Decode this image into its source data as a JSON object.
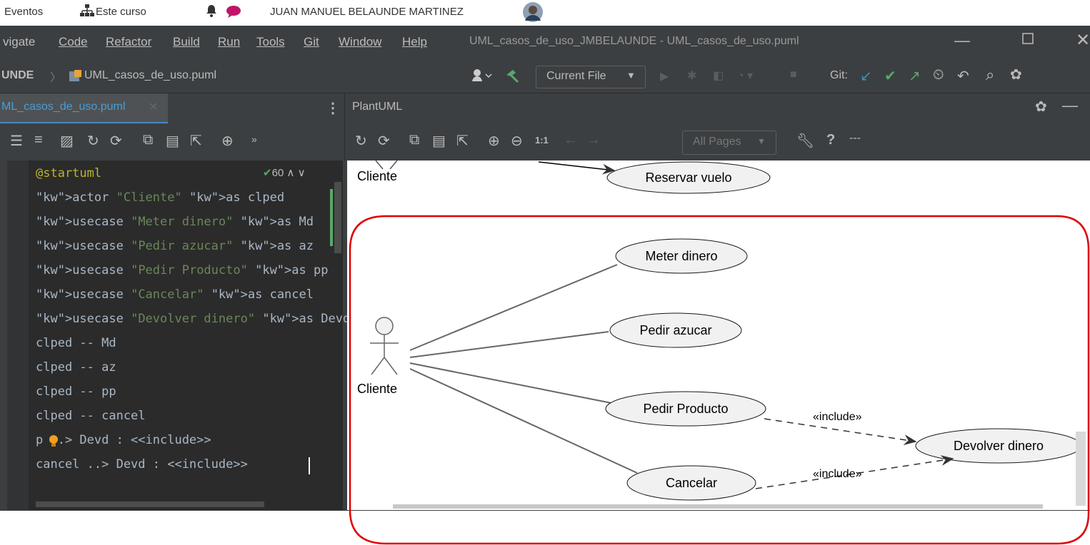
{
  "webbar": {
    "eventos": "Eventos",
    "este_curso": "Este curso",
    "user_name": "JUAN MANUEL BELAUNDE MARTINEZ"
  },
  "menubar": {
    "items": [
      {
        "label": "vigate"
      },
      {
        "label": "Code"
      },
      {
        "label": "Refactor"
      },
      {
        "label": "Build"
      },
      {
        "label": "Run"
      },
      {
        "label": "Tools"
      },
      {
        "label": "Git"
      },
      {
        "label": "Window"
      },
      {
        "label": "Help"
      }
    ],
    "window_title": "UML_casos_de_uso_JMBELAUNDE - UML_casos_de_uso.puml"
  },
  "navbar": {
    "project": "UNDE",
    "file": "UML_casos_de_uso.puml",
    "run_config": "Current File",
    "git_label": "Git:"
  },
  "editor_tab": {
    "label": "ML_casos_de_uso.puml"
  },
  "plantuml_panel": {
    "title": "PlantUML",
    "zoom_label": "1:1",
    "pages_select": "All Pages",
    "more": "---",
    "help": "?"
  },
  "editor": {
    "problems_count": "60",
    "lines": [
      "@startuml",
      "actor \"Cliente\" as clped",
      "usecase \"Meter dinero\" as Md",
      "usecase \"Pedir azucar\" as az",
      "usecase \"Pedir Producto\" as pp",
      "usecase \"Cancelar\" as cancel",
      "usecase \"Devolver dinero\" as Devd",
      "clped -- Md",
      "clped -- az",
      "clped -- pp",
      "clped -- cancel",
      "p ..> Devd : <<include>>",
      "cancel ..> Devd : <<include>>"
    ]
  },
  "diagram": {
    "top_actor": "Cliente",
    "top_usecase": "Reservar vuelo",
    "actor": "Cliente",
    "usecases": {
      "md": "Meter dinero",
      "az": "Pedir azucar",
      "pp": "Pedir Producto",
      "cancel": "Cancelar",
      "devd": "Devolver dinero"
    },
    "include_1": "«include»",
    "include_2": "«include»",
    "highlight_color": "#e00000"
  }
}
